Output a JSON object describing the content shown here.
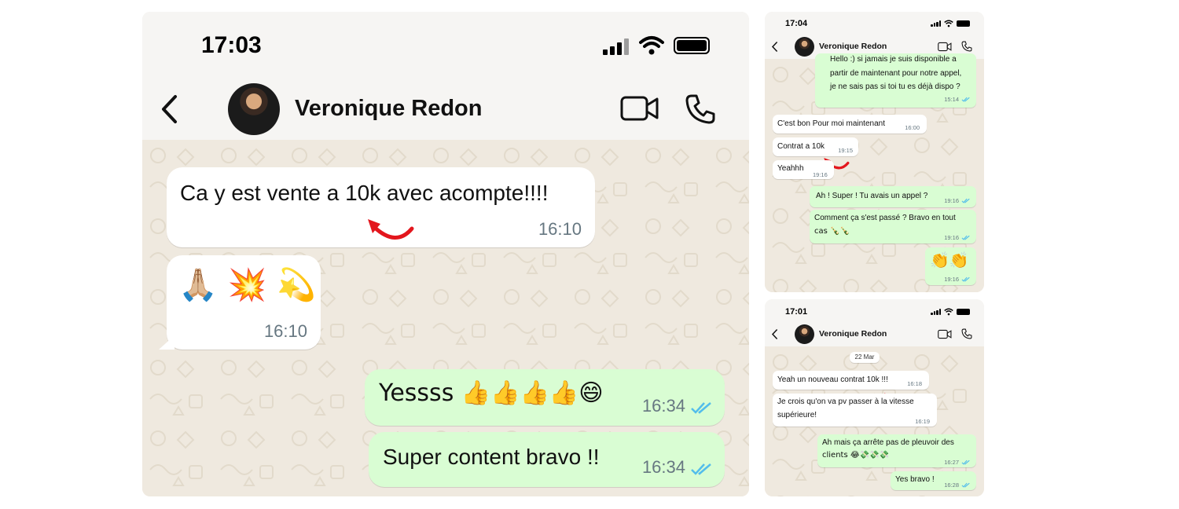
{
  "big": {
    "status_time": "17:03",
    "contact_name": "Veronique Redon",
    "messages": [
      {
        "text": "Ca y est vente a 10k avec acompte!!!!",
        "time": "16:10"
      },
      {
        "text": "🙏🏼 💥 💫",
        "time": "16:10"
      },
      {
        "text": "Yessss 👍👍👍👍😄",
        "time": "16:34"
      },
      {
        "text": "Super content bravo !!",
        "time": "16:34"
      }
    ]
  },
  "top_right": {
    "status_time": "17:04",
    "contact_name": "Veronique Redon",
    "messages": [
      {
        "line1": "Hello :) si jamais je suis disponible a",
        "line2": "partir de maintenant pour notre appel,",
        "line3": "je ne sais pas si toi tu es déjà dispo ?",
        "time": "15:14"
      },
      {
        "text": "C'est bon Pour moi maintenant",
        "time": "16:00"
      },
      {
        "text": "Contrat a 10k",
        "time": "19:15"
      },
      {
        "text": "Yeahhh",
        "time": "19:16"
      },
      {
        "text": "Ah ! Super ! Tu avais un appel ?",
        "time": "19:16"
      },
      {
        "line1": "Comment ça s'est passé ? Bravo en tout",
        "line2": "cas 🍾🍾",
        "time": "19:16"
      },
      {
        "text": "👏👏",
        "time": "19:16"
      }
    ]
  },
  "bottom_right": {
    "status_time": "17:01",
    "contact_name": "Veronique Redon",
    "date_chip": "22 Mar",
    "messages": [
      {
        "text": "Yeah un nouveau contrat 10k !!!",
        "time": "16:18"
      },
      {
        "line1": "Je crois qu'on va pv passer à la vitesse",
        "line2": "supérieure!",
        "time": "16:19"
      },
      {
        "line1": "Ah mais ça arrête pas de pleuvoir des",
        "line2": "clients 😂💸💸💸",
        "time": "16:27"
      },
      {
        "text": "Yes bravo !",
        "time": "16:28"
      }
    ]
  },
  "icons": {
    "back": "back-chevron-icon",
    "video": "video-camera-icon",
    "phone": "phone-icon",
    "read": "double-check-icon",
    "annotation": "red-curved-arrow-icon"
  },
  "colors": {
    "incoming_bubble": "#ffffff",
    "outgoing_bubble": "#d9fdd3",
    "read_ticks": "#53bdeb",
    "wallpaper": "#efe9df",
    "annotation_arrow": "#e3161d"
  }
}
